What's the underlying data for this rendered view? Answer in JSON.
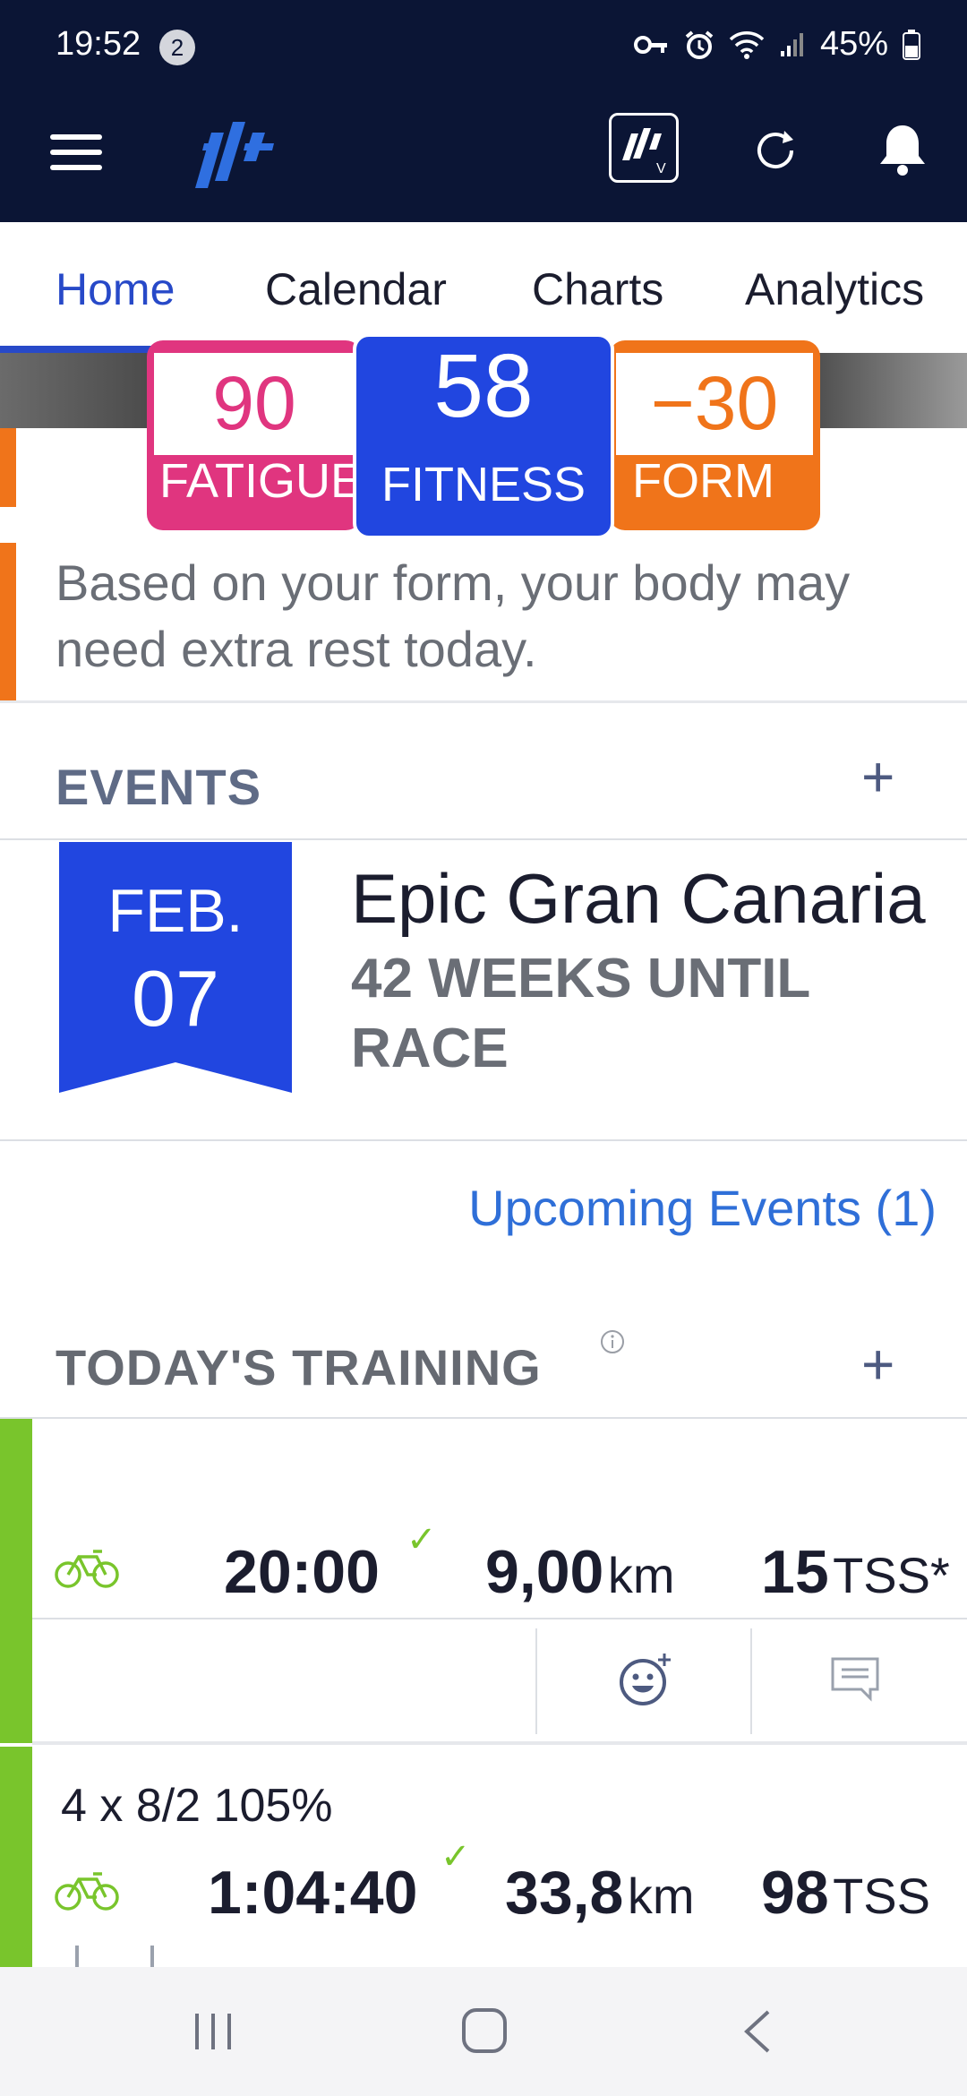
{
  "status": {
    "time": "19:52",
    "notification_count": "2",
    "battery": "45%"
  },
  "tabs": [
    "Home",
    "Calendar",
    "Charts",
    "Analytics"
  ],
  "metrics": {
    "fatigue": {
      "value": "90",
      "label": "FATIGUE"
    },
    "fitness": {
      "value": "58",
      "label": "FITNESS"
    },
    "form": {
      "value": "−30",
      "label": "FORM"
    }
  },
  "form_message": "Based on your form, your body may need extra rest today.",
  "events": {
    "title": "EVENTS",
    "event": {
      "month": "FEB.",
      "day": "07",
      "name": "Epic Gran Canaria",
      "weeks_until": "42 WEEKS UNTIL RACE"
    },
    "upcoming_link": "Upcoming Events (1)"
  },
  "training": {
    "title": "TODAY'S TRAINING",
    "workouts": [
      {
        "title": "",
        "duration": "20:00",
        "distance": "9,00",
        "distance_unit": "km",
        "tss": "15",
        "tss_unit": "TSS*"
      },
      {
        "title": "4 x 8/2 105%",
        "duration": "1:04:40",
        "distance": "33,8",
        "distance_unit": "km",
        "tss": "98",
        "tss_unit": "TSS"
      }
    ]
  },
  "colors": {
    "navy": "#0b1535",
    "blue": "#2749c8",
    "pink": "#e0357f",
    "orange": "#f0741a",
    "green": "#79c52c"
  }
}
